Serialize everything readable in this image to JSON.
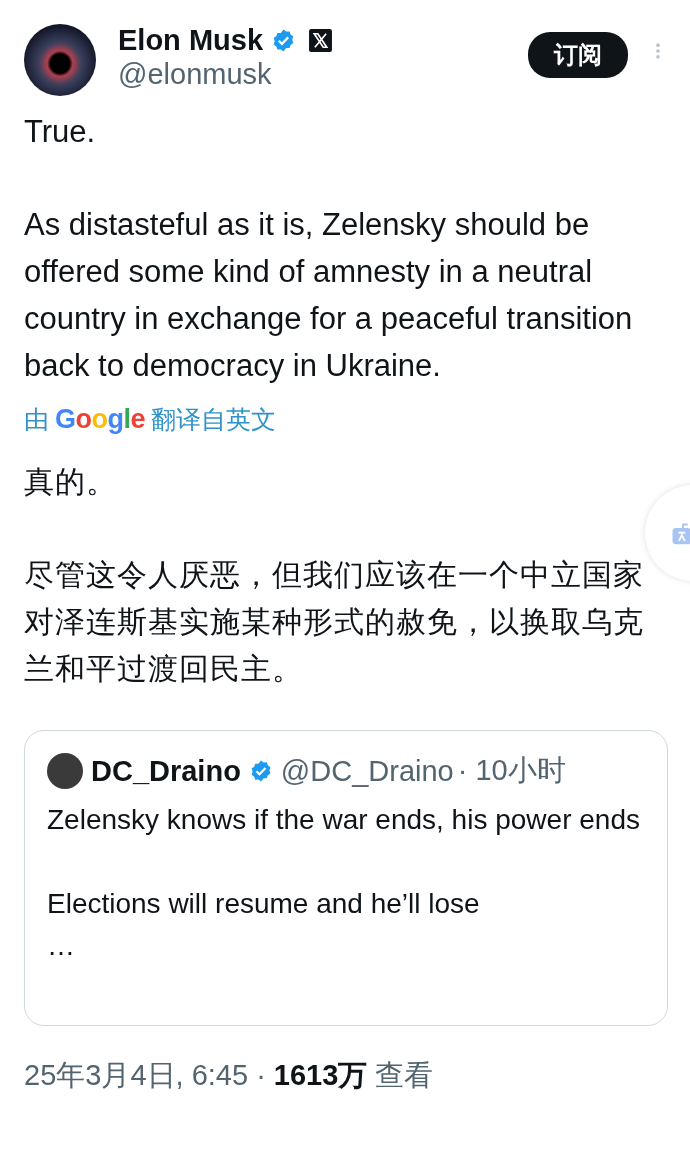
{
  "author": {
    "name": "Elon Musk",
    "handle": "@elonmusk",
    "verified": true,
    "affiliate_badge": true
  },
  "subscribe_button": "订阅",
  "post_paragraphs": [
    "True.",
    "As distasteful as it is, Zelensky should be offered some kind of amnesty in a neutral country in exchange for a peaceful transition back to democracy in Ukraine."
  ],
  "translation_note": {
    "prefix": "由",
    "brand": "Google",
    "suffix": "翻译自英文"
  },
  "translated_paragraphs": [
    "真的。",
    "尽管这令人厌恶，但我们应该在一个中立国家对泽连斯基实施某种形式的赦免，以换取乌克兰和平过渡回民主。"
  ],
  "quoted_post": {
    "name": "DC_Draino",
    "verified": true,
    "handle": "@DC_Draino",
    "time": "· 10小时",
    "paragraphs": [
      "Zelensky knows if the war ends, his power ends",
      "Elections will resume and he’ll lose",
      "…"
    ]
  },
  "footer": "25年3月4日, 6:45 · **1613万** 查看"
}
